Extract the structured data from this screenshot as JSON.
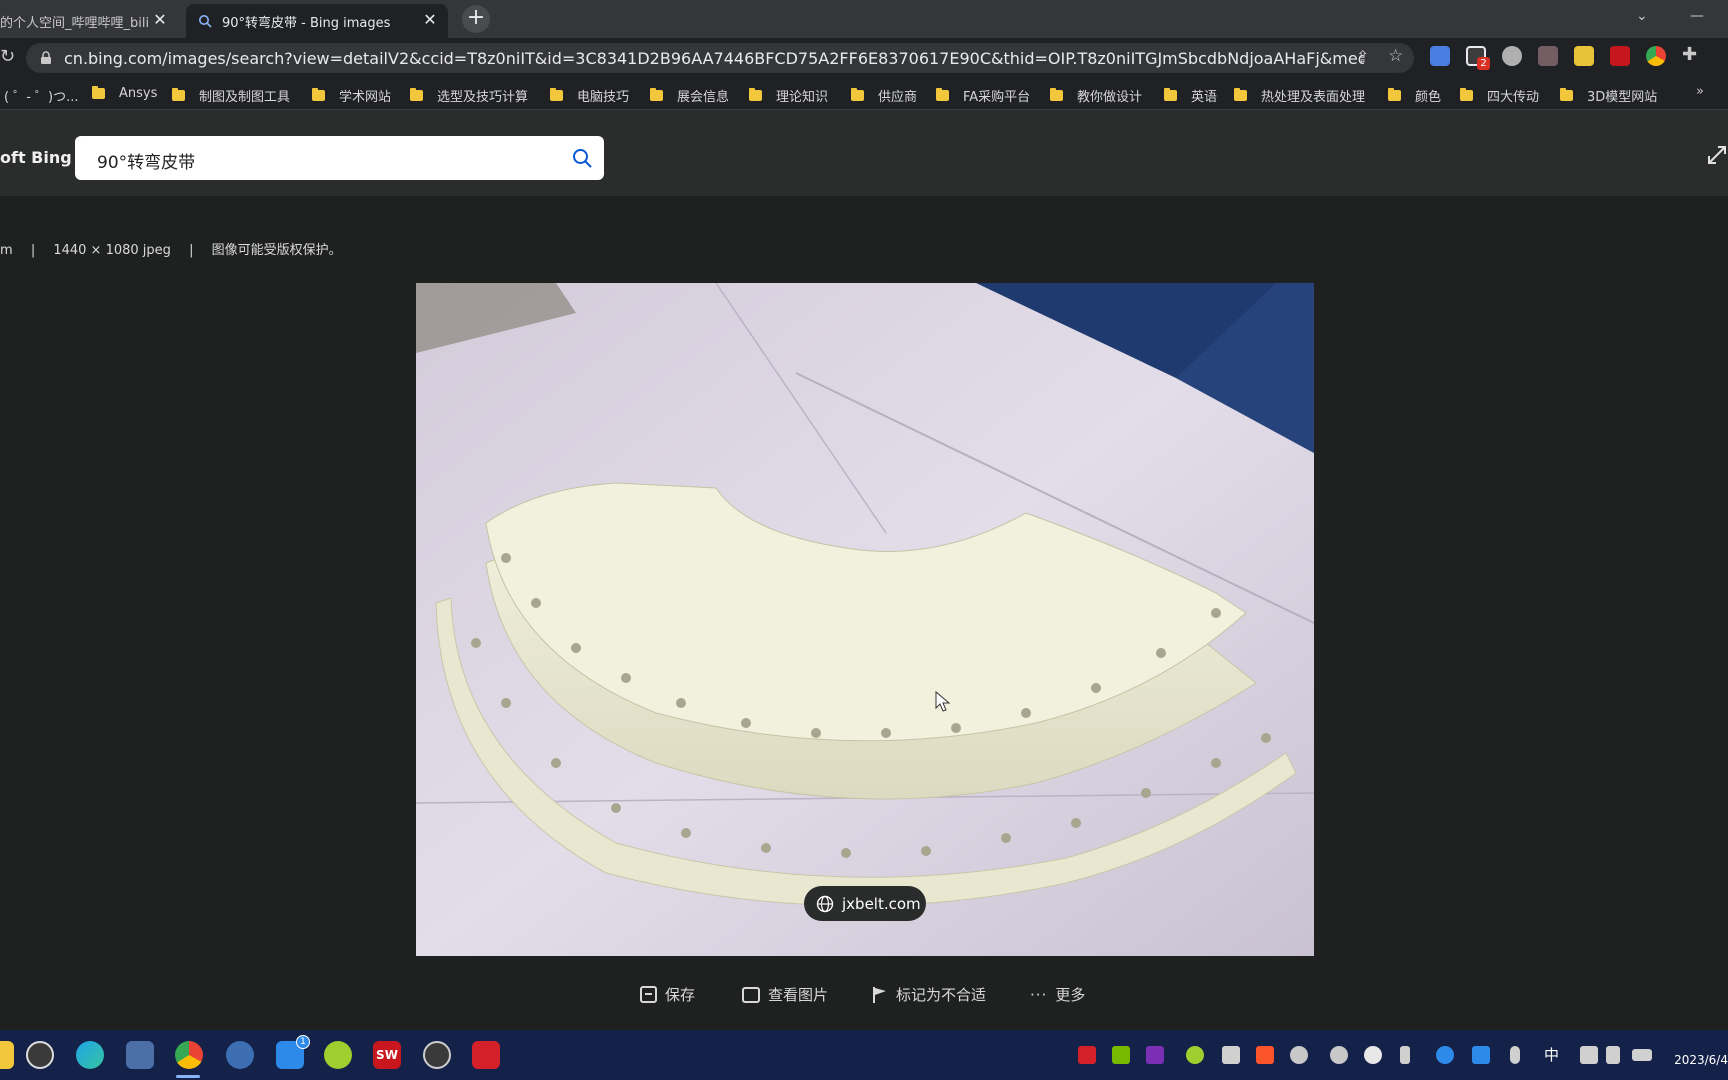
{
  "tabs": [
    {
      "title": "的个人空间_哔哩哔哩_bili",
      "active": false
    },
    {
      "title": "90°转弯皮带 - Bing images",
      "active": true
    }
  ],
  "address_bar": {
    "url": "cn.bing.com/images/search?view=detailV2&ccid=T8z0niIT&id=3C8341D2B96AA7446BFCD75A2FF6E8370617E90C&thid=OIP.T8z0niITGJmSbcdbNdjoaAHaFj&mediaur..."
  },
  "bookmarks": [
    {
      "label": "( ゜- ゜)つ..."
    },
    {
      "label": "Ansys"
    },
    {
      "label": "制图及制图工具"
    },
    {
      "label": "学术网站"
    },
    {
      "label": "选型及技巧计算"
    },
    {
      "label": "电脑技巧"
    },
    {
      "label": "展会信息"
    },
    {
      "label": "理论知识"
    },
    {
      "label": "供应商"
    },
    {
      "label": "FA采购平台"
    },
    {
      "label": "教你做设计"
    },
    {
      "label": "英语"
    },
    {
      "label": "热处理及表面处理"
    },
    {
      "label": "颜色"
    },
    {
      "label": "四大传动"
    },
    {
      "label": "3D模型网站"
    }
  ],
  "bing": {
    "logo_text": "oft Bing",
    "search_query": "90°转弯皮带",
    "meta": {
      "prefix": "m",
      "dimensions": "1440 × 1080 jpeg",
      "copyright": "图像可能受版权保护。"
    },
    "source_domain": "jxbelt.com",
    "actions": [
      {
        "label": "保存",
        "icon": "save-icon"
      },
      {
        "label": "查看图片",
        "icon": "view-image-icon"
      },
      {
        "label": "标记为不合适",
        "icon": "flag-icon"
      },
      {
        "label": "更多",
        "icon": "more-icon"
      }
    ]
  },
  "taskbar": {
    "clock": "2023/6/4",
    "mail_badge": "1",
    "ext_badge": "2",
    "ime": "中",
    "sw_label": "SW"
  },
  "colors": {
    "accent_blue": "#0b57d0",
    "taskbar": "#14224a",
    "folder": "#f3c73c"
  }
}
